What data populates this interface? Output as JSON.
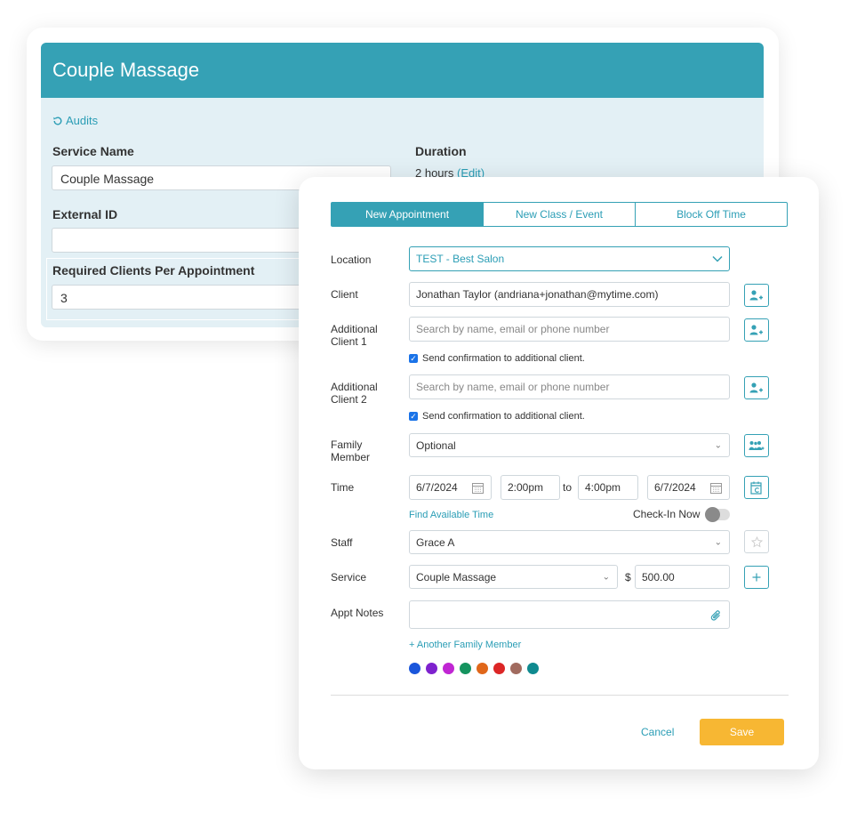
{
  "service_card": {
    "title": "Couple Massage",
    "audits_label": "Audits",
    "service_name_label": "Service Name",
    "service_name_value": "Couple Massage",
    "duration_label": "Duration",
    "duration_value": "2 hours",
    "duration_edit": "(Edit)",
    "external_id_label": "External ID",
    "external_id_value": "",
    "required_clients_label": "Required Clients Per Appointment",
    "required_clients_value": "3"
  },
  "appointment": {
    "tabs": [
      {
        "label": "New Appointment",
        "active": true
      },
      {
        "label": "New Class / Event",
        "active": false
      },
      {
        "label": "Block Off Time",
        "active": false
      }
    ],
    "location": {
      "label": "Location",
      "value": "TEST - Best Salon"
    },
    "client": {
      "label": "Client",
      "value": "Jonathan Taylor (andriana+jonathan@mytime.com)"
    },
    "additional_client_1": {
      "label_line1": "Additional",
      "label_line2": "Client 1",
      "placeholder": "Search by name, email or phone number",
      "confirm_label": "Send confirmation to additional client."
    },
    "additional_client_2": {
      "label_line1": "Additional",
      "label_line2": "Client 2",
      "placeholder": "Search by name, email or phone number",
      "confirm_label": "Send confirmation to additional client."
    },
    "family_member": {
      "label_line1": "Family",
      "label_line2": "Member",
      "value": "Optional"
    },
    "time": {
      "label": "Time",
      "start_date": "6/7/2024",
      "start_time": "2:00pm",
      "to_label": "to",
      "end_time": "4:00pm",
      "end_date": "6/7/2024",
      "find_available": "Find Available Time",
      "checkin_label": "Check-In Now"
    },
    "staff": {
      "label": "Staff",
      "value": "Grace A"
    },
    "service": {
      "label": "Service",
      "value": "Couple Massage",
      "currency": "$",
      "price": "500.00"
    },
    "notes": {
      "label": "Appt Notes",
      "value": ""
    },
    "another_family": "+ Another Family Member",
    "color_swatches": [
      "#1a56db",
      "#7e22ce",
      "#c026d3",
      "#15935f",
      "#e0671a",
      "#dc2626",
      "#a16b5f",
      "#0f8a8f"
    ],
    "cancel_label": "Cancel",
    "save_label": "Save"
  },
  "colors": {
    "accent": "#35a1b5",
    "save": "#f7b733",
    "back_panel": "#e3f0f5"
  }
}
